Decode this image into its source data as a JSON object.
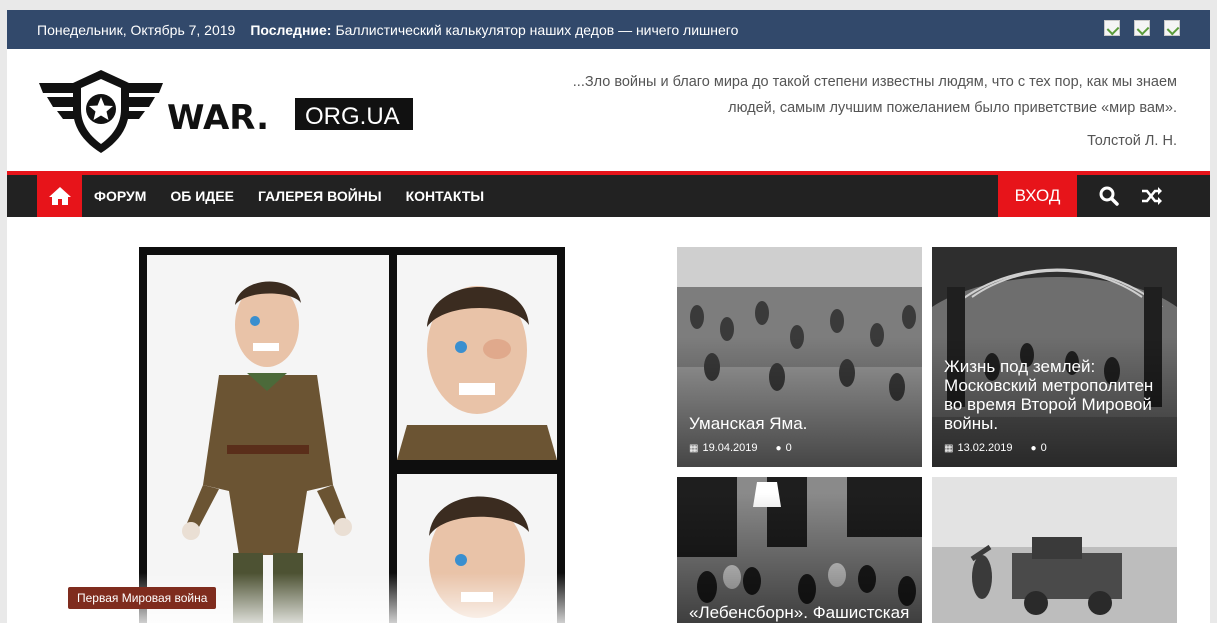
{
  "topbar": {
    "date": "Понедельник, Октябрь 7, 2019",
    "latest_label": "Последние:",
    "latest_text": "Баллистический калькулятор наших дедов — ничего лишнего"
  },
  "header": {
    "logo_text": "WAR.",
    "logo_domain": "ORG.UA",
    "tagline": "...Зло войны и благо мира до такой степени известны людям, что с тех пор, как мы знаем людей, самым лучшим пожеланием было приветствие «мир вам».",
    "author": "Толстой Л. Н."
  },
  "nav": {
    "items": [
      "ФОРУМ",
      "ОБ ИДЕЕ",
      "ГАЛЕРЕЯ ВОЙНЫ",
      "КОНТАКТЫ"
    ],
    "login": "ВХОД",
    "icons": [
      "home-icon",
      "search-icon",
      "shuffle-icon"
    ]
  },
  "feature": {
    "category": "Первая Мировая война"
  },
  "tiles": [
    {
      "title": "Уманская Яма.",
      "date": "19.04.2019",
      "comments": "0"
    },
    {
      "title": "Жизнь под землей: Московский метрополитен во время Второй Мировой войны.",
      "date": "13.02.2019",
      "comments": "0"
    },
    {
      "title": "«Лебенсборн». Фашистская"
    },
    {
      "title": ""
    }
  ],
  "colors": {
    "accent": "#e7141a",
    "topbar": "#32496b",
    "nav": "#222222",
    "badge": "#7f2c1e"
  }
}
